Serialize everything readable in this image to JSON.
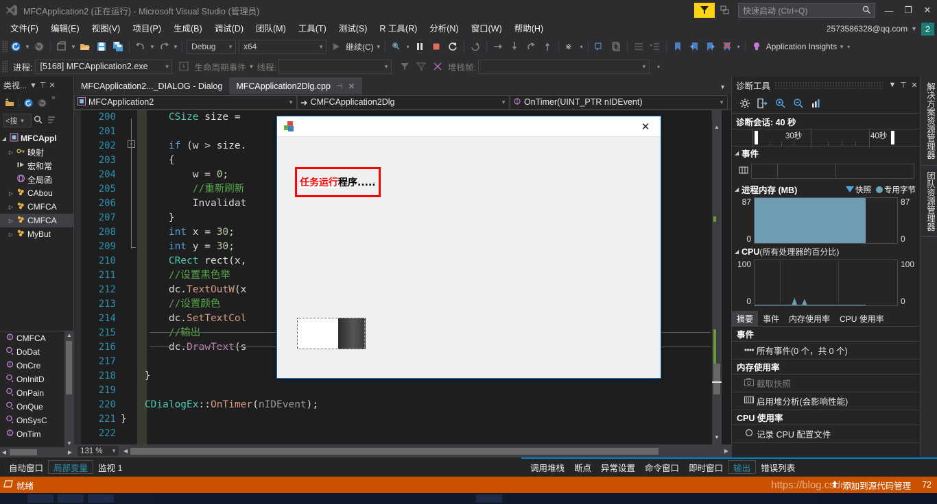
{
  "titlebar": {
    "title": "MFCApplication2 (正在运行) - Microsoft Visual Studio (管理员)",
    "quick_launch_placeholder": "快速启动 (Ctrl+Q)",
    "minimize": "—",
    "restore": "❐",
    "close": "✕"
  },
  "menubar": {
    "items": [
      {
        "label": "文件(F)"
      },
      {
        "label": "编辑(E)"
      },
      {
        "label": "视图(V)"
      },
      {
        "label": "项目(P)"
      },
      {
        "label": "生成(B)"
      },
      {
        "label": "调试(D)"
      },
      {
        "label": "团队(M)"
      },
      {
        "label": "工具(T)"
      },
      {
        "label": "测试(S)"
      },
      {
        "label": "R 工具(R)"
      },
      {
        "label": "分析(N)"
      },
      {
        "label": "窗口(W)"
      },
      {
        "label": "帮助(H)"
      }
    ],
    "account": "2573586328@qq.com",
    "account_badge": "2"
  },
  "toolbar": {
    "config": "Debug",
    "platform": "x64",
    "continue_label": "继续(C)",
    "app_insights": "Application Insights"
  },
  "debug_toolbar": {
    "process_label": "进程:",
    "process_value": "[5168] MFCApplication2.exe",
    "lifecycle_label": "生命周期事件",
    "thread_label": "线程:",
    "thread_value": "",
    "stackframe_label": "堆栈帧:",
    "stackframe_value": ""
  },
  "left_panel": {
    "title": "类视...",
    "search_placeholder": "<搜",
    "tree": [
      {
        "label": "MFCAppl",
        "icon": "project-icon",
        "arrow": "▲",
        "bold": true,
        "indent": 0
      },
      {
        "label": "映射",
        "icon": "key-icon",
        "arrow": "▶",
        "bold": false,
        "indent": 1
      },
      {
        "label": "宏和常",
        "icon": "macro-icon",
        "arrow": "",
        "bold": false,
        "indent": 1
      },
      {
        "label": "全局函",
        "icon": "globe-icon",
        "arrow": "",
        "bold": false,
        "indent": 1
      },
      {
        "label": "CAbou",
        "icon": "class-icon",
        "arrow": "▶",
        "bold": false,
        "indent": 1
      },
      {
        "label": "CMFCA",
        "icon": "class-icon",
        "arrow": "▶",
        "bold": false,
        "indent": 1
      },
      {
        "label": "CMFCA",
        "icon": "class-icon",
        "arrow": "▶",
        "bold": false,
        "indent": 1,
        "selected": true
      },
      {
        "label": "MyBut",
        "icon": "class-icon",
        "arrow": "▶",
        "bold": false,
        "indent": 1
      }
    ],
    "members": [
      {
        "label": "CMFCA",
        "icon": "method-icon"
      },
      {
        "label": "DoDat",
        "icon": "method-protected-icon"
      },
      {
        "label": "OnCre",
        "icon": "method-icon"
      },
      {
        "label": "OnInitD",
        "icon": "method-protected-icon"
      },
      {
        "label": "OnPain",
        "icon": "method-protected-icon"
      },
      {
        "label": "OnQue",
        "icon": "method-protected-icon"
      },
      {
        "label": "OnSysC",
        "icon": "method-protected-icon"
      },
      {
        "label": "OnTim",
        "icon": "method-icon"
      }
    ]
  },
  "editor": {
    "tabs": [
      {
        "label": "MFCApplication2..._DIALOG - Dialog",
        "active": false
      },
      {
        "label": "MFCApplication2Dlg.cpp",
        "active": true,
        "pin": "⊣",
        "close": "✕"
      }
    ],
    "nav_project": "MFCApplication2",
    "nav_class": "CMFCApplication2Dlg",
    "nav_member": "OnTimer(UINT_PTR nIDEvent)",
    "zoom": "131 %",
    "lines": [
      {
        "num": "200",
        "tokens": [
          {
            "t": "        ",
            "c": "pln"
          },
          {
            "t": "CSize",
            "c": "type"
          },
          {
            "t": " size = ",
            "c": "pln"
          }
        ]
      },
      {
        "num": "201",
        "tokens": []
      },
      {
        "num": "202",
        "tokens": [
          {
            "t": "        ",
            "c": "pln"
          },
          {
            "t": "if",
            "c": "kw"
          },
          {
            "t": " (w > size.",
            "c": "pln"
          }
        ],
        "fold": "−"
      },
      {
        "num": "203",
        "tokens": [
          {
            "t": "        {",
            "c": "pln"
          }
        ]
      },
      {
        "num": "204",
        "tokens": [
          {
            "t": "            w = ",
            "c": "pln"
          },
          {
            "t": "0",
            "c": "num"
          },
          {
            "t": ";",
            "c": "pln"
          }
        ]
      },
      {
        "num": "205",
        "tokens": [
          {
            "t": "            //重新刷新",
            "c": "cmt"
          }
        ]
      },
      {
        "num": "206",
        "tokens": [
          {
            "t": "            ",
            "c": "pln"
          },
          {
            "t": "Invalidat",
            "c": "pln"
          }
        ]
      },
      {
        "num": "207",
        "tokens": [
          {
            "t": "        }",
            "c": "pln"
          }
        ]
      },
      {
        "num": "208",
        "tokens": [
          {
            "t": "        ",
            "c": "pln"
          },
          {
            "t": "int",
            "c": "kw"
          },
          {
            "t": " x = ",
            "c": "pln"
          },
          {
            "t": "30",
            "c": "num"
          },
          {
            "t": ";",
            "c": "pln"
          }
        ]
      },
      {
        "num": "209",
        "tokens": [
          {
            "t": "        ",
            "c": "pln"
          },
          {
            "t": "int",
            "c": "kw"
          },
          {
            "t": " y = ",
            "c": "pln"
          },
          {
            "t": "30",
            "c": "num"
          },
          {
            "t": ";",
            "c": "pln"
          }
        ]
      },
      {
        "num": "210",
        "tokens": [
          {
            "t": "        ",
            "c": "pln"
          },
          {
            "t": "CRect",
            "c": "type"
          },
          {
            "t": " rect(x,",
            "c": "pln"
          }
        ]
      },
      {
        "num": "211",
        "tokens": [
          {
            "t": "        //设置黑色举",
            "c": "cmt"
          }
        ]
      },
      {
        "num": "212",
        "tokens": [
          {
            "t": "        dc.",
            "c": "pln"
          },
          {
            "t": "TextOutW",
            "c": "mth"
          },
          {
            "t": "(x",
            "c": "pln"
          }
        ]
      },
      {
        "num": "213",
        "tokens": [
          {
            "t": "        //设置颜色",
            "c": "cmt"
          }
        ]
      },
      {
        "num": "214",
        "tokens": [
          {
            "t": "        dc.",
            "c": "pln"
          },
          {
            "t": "SetTextCol",
            "c": "mth"
          }
        ]
      },
      {
        "num": "215",
        "tokens": [
          {
            "t": "        //输出",
            "c": "cmt"
          }
        ],
        "highlight": true
      },
      {
        "num": "216",
        "tokens": [
          {
            "t": "        dc.",
            "c": "pln"
          },
          {
            "t": "DrawText",
            "c": "pur"
          },
          {
            "t": "(s",
            "c": "pln"
          }
        ]
      },
      {
        "num": "217",
        "tokens": []
      },
      {
        "num": "218",
        "tokens": [
          {
            "t": "    }",
            "c": "pln"
          }
        ]
      },
      {
        "num": "219",
        "tokens": []
      },
      {
        "num": "220",
        "tokens": [
          {
            "t": "    ",
            "c": "pln"
          },
          {
            "t": "CDialogEx",
            "c": "type"
          },
          {
            "t": "::",
            "c": "pln"
          },
          {
            "t": "OnTimer",
            "c": "mth"
          },
          {
            "t": "(",
            "c": "pln"
          },
          {
            "t": "nIDEvent",
            "c": "param"
          },
          {
            "t": ");",
            "c": "pln"
          }
        ]
      },
      {
        "num": "221",
        "tokens": [
          {
            "t": "}",
            "c": "pln"
          }
        ]
      },
      {
        "num": "222",
        "tokens": []
      }
    ]
  },
  "mfc_dialog": {
    "icon": "mfc-app-icon",
    "close": "✕",
    "message_red": "任务运行",
    "message_black": "程序....."
  },
  "diagnostics": {
    "title": "诊断工具",
    "header_icons": [
      "chevron-down-icon",
      "pin-icon",
      "close-icon"
    ],
    "toolbar_icons": [
      "gear-icon",
      "export-icon",
      "zoom-in-icon",
      "zoom-out-icon",
      "chart-icon"
    ],
    "session_label": "诊断会话: 40 秒",
    "ruler_labels": [
      "30秒",
      "40秒"
    ],
    "events_section": "事件",
    "memory_section": "进程内存 (MB)",
    "memory_legend_snapshot": "快照",
    "memory_legend_private": "专用字节",
    "cpu_section_bold": "CPU",
    "cpu_section_rest": " (所有处理器的百分比)",
    "tabs": [
      {
        "label": "摘要",
        "active": true
      },
      {
        "label": "事件",
        "active": false
      },
      {
        "label": "内存使用率",
        "active": false
      },
      {
        "label": "CPU 使用率",
        "active": false
      }
    ],
    "groups": [
      {
        "title": "事件",
        "items": [
          {
            "label": "所有事件(0 个，共 0 个)",
            "icon": "events-icon",
            "disabled": false
          }
        ]
      },
      {
        "title": "内存使用率",
        "items": [
          {
            "label": "截取快照",
            "icon": "camera-icon",
            "disabled": true
          },
          {
            "label": "启用堆分析(会影响性能)",
            "icon": "heap-icon",
            "disabled": false
          }
        ]
      },
      {
        "title": "CPU 使用率",
        "items": [
          {
            "label": "记录 CPU 配置文件",
            "icon": "record-icon",
            "disabled": false
          }
        ]
      }
    ]
  },
  "chart_data": [
    {
      "type": "area",
      "title": "进程内存 (MB)",
      "ylabel_left": "87",
      "ylabel_left_min": "0",
      "ylabel_right": "87",
      "ylabel_right_min": "0",
      "ylim": [
        0,
        87
      ],
      "legend": [
        "快照",
        "专用字节"
      ],
      "legend_position": "top-right",
      "grid": true,
      "series": [
        {
          "name": "专用字节",
          "values": [
            87,
            87,
            87,
            87,
            87,
            87,
            87,
            87,
            87,
            87,
            87,
            87,
            0,
            0
          ]
        }
      ],
      "fill_color": "#6e9db3",
      "x": [
        0,
        4,
        8,
        12,
        16,
        20,
        24,
        28,
        32,
        36,
        40,
        44,
        46,
        50
      ]
    },
    {
      "type": "area",
      "title": "CPU (所有处理器的百分比)",
      "ylabel_left": "100",
      "ylabel_left_min": "0",
      "ylabel_right": "100",
      "ylabel_right_min": "0",
      "ylim": [
        0,
        100
      ],
      "grid": true,
      "series": [
        {
          "name": "CPU",
          "values": [
            0,
            0,
            0,
            0,
            0,
            0,
            0,
            12,
            0,
            10,
            0,
            0,
            0,
            0
          ]
        }
      ],
      "fill_color": "#6e9db3",
      "x": [
        0,
        4,
        8,
        12,
        16,
        20,
        24,
        28,
        32,
        36,
        40,
        44,
        46,
        50
      ]
    }
  ],
  "vertical_tabs": [
    {
      "label": "解决方案资源管理器"
    },
    {
      "label": "团队资源管理器"
    }
  ],
  "bottom_left_tabs": [
    {
      "label": "自动窗口",
      "active": false
    },
    {
      "label": "局部变量",
      "active": true
    },
    {
      "label": "监视 1",
      "active": false
    }
  ],
  "bottom_right_tabs": [
    {
      "label": "调用堆栈",
      "active": false
    },
    {
      "label": "断点",
      "active": false
    },
    {
      "label": "异常设置",
      "active": false
    },
    {
      "label": "命令窗口",
      "active": false
    },
    {
      "label": "即时窗口",
      "active": false
    },
    {
      "label": "输出",
      "active": true
    },
    {
      "label": "错误列表",
      "active": false
    }
  ],
  "statusbar": {
    "status": "就绪",
    "source_control": "添加到源代码管理",
    "watermark": "https://blog.csdn.n",
    "extra": "72"
  }
}
